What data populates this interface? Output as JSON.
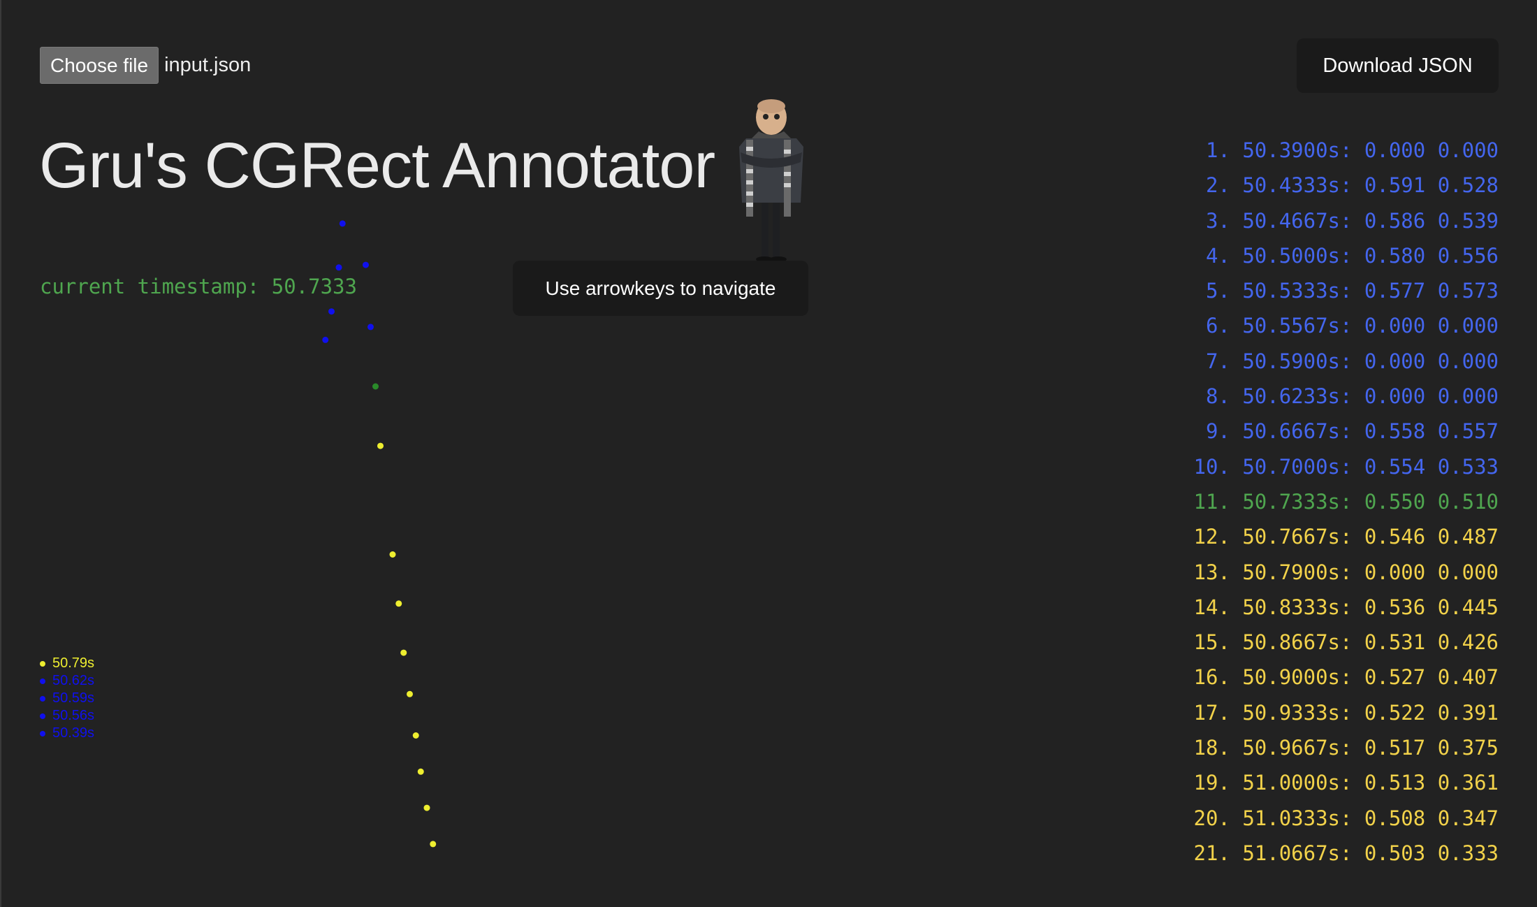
{
  "file_picker": {
    "button_label": "Choose file",
    "file_name": "input.json"
  },
  "download": {
    "label": "Download JSON"
  },
  "title": "Gru's CGRect Annotator",
  "current_timestamp": "current timestamp: 50.7333",
  "hint": "Use arrowkeys to navigate",
  "colors": {
    "past": "#4466ee",
    "current": "#4fa64f",
    "future": "#f2d24a",
    "plot_past": "#1010ee",
    "plot_future": "#eeee30",
    "plot_current": "#2a8a2a"
  },
  "legend": [
    {
      "label": "50.79s",
      "state": "future"
    },
    {
      "label": "50.62s",
      "state": "past"
    },
    {
      "label": "50.59s",
      "state": "past"
    },
    {
      "label": "50.56s",
      "state": "past"
    },
    {
      "label": "50.39s",
      "state": "past"
    }
  ],
  "timestamps": [
    {
      "index": "1.",
      "time": "50.3900s:",
      "x": "0.000",
      "y": "0.000",
      "state": "past"
    },
    {
      "index": "2.",
      "time": "50.4333s:",
      "x": "0.591",
      "y": "0.528",
      "state": "past"
    },
    {
      "index": "3.",
      "time": "50.4667s:",
      "x": "0.586",
      "y": "0.539",
      "state": "past"
    },
    {
      "index": "4.",
      "time": "50.5000s:",
      "x": "0.580",
      "y": "0.556",
      "state": "past"
    },
    {
      "index": "5.",
      "time": "50.5333s:",
      "x": "0.577",
      "y": "0.573",
      "state": "past"
    },
    {
      "index": "6.",
      "time": "50.5567s:",
      "x": "0.000",
      "y": "0.000",
      "state": "past"
    },
    {
      "index": "7.",
      "time": "50.5900s:",
      "x": "0.000",
      "y": "0.000",
      "state": "past"
    },
    {
      "index": "8.",
      "time": "50.6233s:",
      "x": "0.000",
      "y": "0.000",
      "state": "past"
    },
    {
      "index": "9.",
      "time": "50.6667s:",
      "x": "0.558",
      "y": "0.557",
      "state": "past"
    },
    {
      "index": "10.",
      "time": "50.7000s:",
      "x": "0.554",
      "y": "0.533",
      "state": "past"
    },
    {
      "index": "11.",
      "time": "50.7333s:",
      "x": "0.550",
      "y": "0.510",
      "state": "current"
    },
    {
      "index": "12.",
      "time": "50.7667s:",
      "x": "0.546",
      "y": "0.487",
      "state": "future"
    },
    {
      "index": "13.",
      "time": "50.7900s:",
      "x": "0.000",
      "y": "0.000",
      "state": "future"
    },
    {
      "index": "14.",
      "time": "50.8333s:",
      "x": "0.536",
      "y": "0.445",
      "state": "future"
    },
    {
      "index": "15.",
      "time": "50.8667s:",
      "x": "0.531",
      "y": "0.426",
      "state": "future"
    },
    {
      "index": "16.",
      "time": "50.9000s:",
      "x": "0.527",
      "y": "0.407",
      "state": "future"
    },
    {
      "index": "17.",
      "time": "50.9333s:",
      "x": "0.522",
      "y": "0.391",
      "state": "future"
    },
    {
      "index": "18.",
      "time": "50.9667s:",
      "x": "0.517",
      "y": "0.375",
      "state": "future"
    },
    {
      "index": "19.",
      "time": "51.0000s:",
      "x": "0.513",
      "y": "0.361",
      "state": "future"
    },
    {
      "index": "20.",
      "time": "51.0333s:",
      "x": "0.508",
      "y": "0.347",
      "state": "future"
    },
    {
      "index": "21.",
      "time": "51.0667s:",
      "x": "0.503",
      "y": "0.333",
      "state": "future"
    }
  ]
}
